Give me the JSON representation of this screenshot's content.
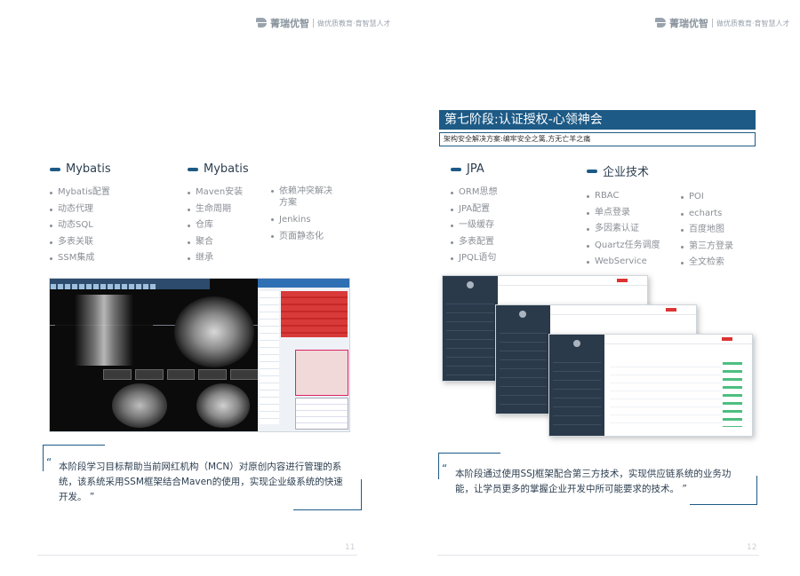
{
  "brand": {
    "name": "菁瑞优智",
    "slogan": "做优质教育·育智慧人才"
  },
  "left": {
    "columns": [
      {
        "title": "Mybatis",
        "items": [
          "Mybatis配置",
          "动态代理",
          "动态SQL",
          "多表关联",
          "SSM集成"
        ]
      },
      {
        "title": "Mybatis",
        "items": [
          "Maven安装",
          "生命周期",
          "仓库",
          "聚合",
          "继承"
        ]
      },
      {
        "title": "",
        "items": [
          "依赖冲突解决方案",
          "Jenkins",
          "页面静态化"
        ]
      }
    ],
    "quote": "本阶段学习目标帮助当前网红机构（MCN）对原创内容进行管理的系统，该系统采用SSM框架结合Maven的使用，实现企业级系统的快速开发。",
    "quote_open": "“",
    "quote_close": "”",
    "page_number": "11"
  },
  "right": {
    "stage_title": "第七阶段:认证授权-心领神会",
    "stage_subtitle": "架构安全解决方案:编牢安全之篱,方无亡羊之痛",
    "columns": [
      {
        "title": "JPA",
        "items": [
          "ORM思想",
          "JPA配置",
          "一级缓存",
          "多表配置",
          "JPQL语句"
        ]
      },
      {
        "title": "企业技术",
        "items": [
          "RBAC",
          "单点登录",
          "多因素认证",
          "Quartz任务调度",
          "WebService"
        ]
      },
      {
        "title": "",
        "items": [
          "POI",
          "echarts",
          "百度地图",
          "第三方登录",
          "全文检索"
        ]
      }
    ],
    "quote": "本阶段通过使用SSJ框架配合第三方技术，实现供应链系统的业务功能，让学员更多的掌握企业开发中所可能要求的技术。",
    "quote_open": "“",
    "quote_close": "”",
    "page_number": "12"
  },
  "colors": {
    "accent": "#1d5a86",
    "title_bar": "#1d5a86",
    "item_text": "#8a8f96"
  }
}
